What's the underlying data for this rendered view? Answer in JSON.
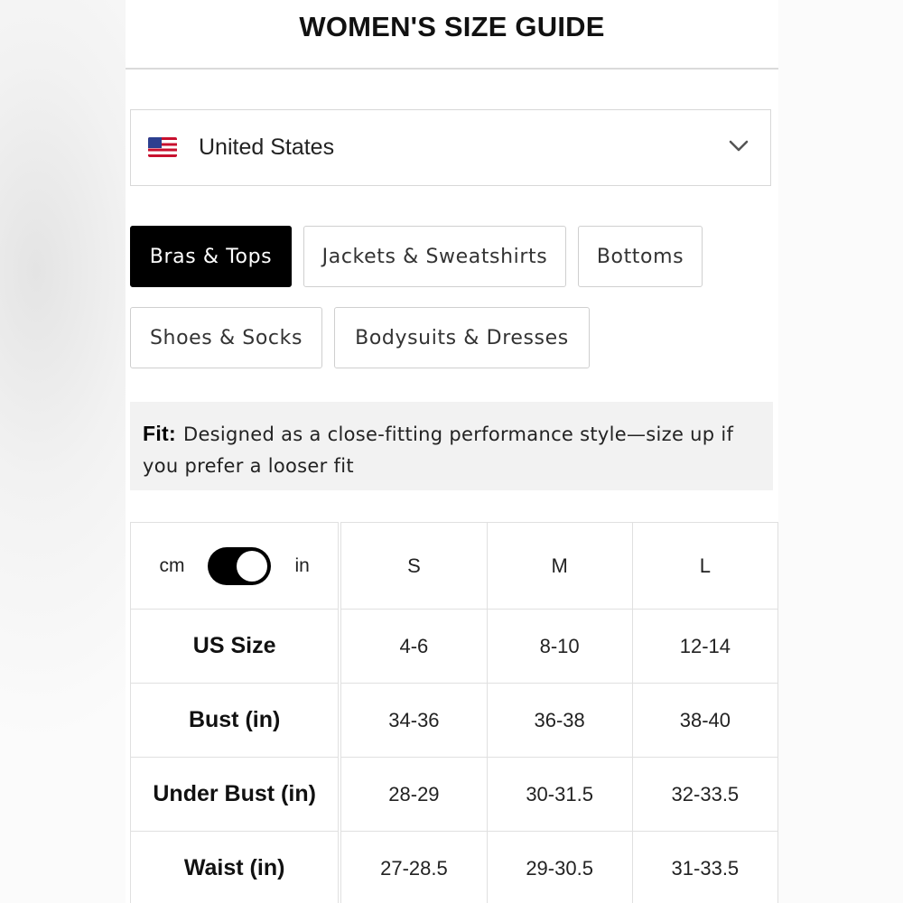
{
  "header": {
    "title": "WOMEN'S SIZE GUIDE"
  },
  "region": {
    "flag_icon": "us-flag-icon",
    "selected": "United States"
  },
  "tabs": [
    {
      "label": "Bras & Tops",
      "active": true
    },
    {
      "label": "Jackets & Sweatshirts",
      "active": false
    },
    {
      "label": "Bottoms",
      "active": false
    },
    {
      "label": "Shoes & Socks",
      "active": false
    },
    {
      "label": "Bodysuits & Dresses",
      "active": false
    }
  ],
  "fit": {
    "label": "Fit:",
    "text": "Designed as a close-fitting performance style—size up if you prefer a looser fit"
  },
  "units": {
    "left": "cm",
    "right": "in",
    "selected": "in"
  },
  "table": {
    "columns": [
      "S",
      "M",
      "L"
    ],
    "rows": [
      {
        "label": "US Size",
        "values": [
          "4-6",
          "8-10",
          "12-14"
        ]
      },
      {
        "label": "Bust (in)",
        "values": [
          "34-36",
          "36-38",
          "38-40"
        ]
      },
      {
        "label": "Under Bust (in)",
        "values": [
          "28-29",
          "30-31.5",
          "32-33.5"
        ]
      },
      {
        "label": "Waist (in)",
        "values": [
          "27-28.5",
          "29-30.5",
          "31-33.5"
        ]
      }
    ]
  },
  "colors": {
    "active_tab": "#000000",
    "fit_background": "#f2f2f2",
    "border": "#d8d8d8"
  }
}
